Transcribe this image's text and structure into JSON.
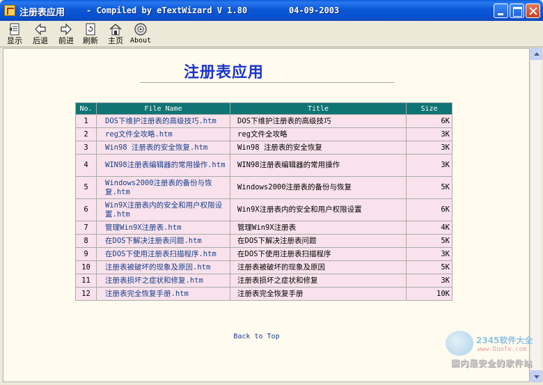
{
  "window": {
    "title": "注册表应用",
    "compiled": "- Compiled by eTextWizard V 1.80",
    "date": "04-09-2003"
  },
  "toolbar": {
    "show_label": "显示",
    "back_label": "后退",
    "forward_label": "前进",
    "refresh_label": "刷新",
    "home_label": "主页",
    "about_label": "About"
  },
  "page": {
    "title": "注册表应用",
    "back_to_top": "Back to Top"
  },
  "table": {
    "headers": [
      "No.",
      "File Name",
      "Title",
      "Size"
    ],
    "rows": [
      {
        "no": "1",
        "file": "DOS下维护注册表的高级技巧.htm",
        "title": "DOS下维护注册表的高级技巧",
        "size": "6K"
      },
      {
        "no": "2",
        "file": "reg文件全攻略.htm",
        "title": "reg文件全攻略",
        "size": "3K"
      },
      {
        "no": "3",
        "file": "Win98 注册表的安全恢复.htm",
        "title": "Win98 注册表的安全恢复",
        "size": "3K"
      },
      {
        "no": "4",
        "file": "WIN98注册表编辑器的常用操作.htm",
        "title": "WIN98注册表编辑器的常用操作",
        "size": "3K"
      },
      {
        "no": "5",
        "file": "Windows2000注册表的备份与恢复.htm",
        "title": "Windows2000注册表的备份与恢复",
        "size": "5K"
      },
      {
        "no": "6",
        "file": "Win9X注册表内的安全和用户权限设置.htm",
        "title": "Win9X注册表内的安全和用户权限设置",
        "size": "6K"
      },
      {
        "no": "7",
        "file": "管理Win9X注册表.htm",
        "title": "管理Win9X注册表",
        "size": "4K"
      },
      {
        "no": "8",
        "file": "在DOS下解决注册表问题.htm",
        "title": "在DOS下解决注册表问题",
        "size": "5K"
      },
      {
        "no": "9",
        "file": "在DOS下使用注册表扫描程序.htm",
        "title": "在DOS下使用注册表扫描程序",
        "size": "3K"
      },
      {
        "no": "10",
        "file": "注册表被破坏的现象及原因.htm",
        "title": "注册表被破坏的现象及原因",
        "size": "5K"
      },
      {
        "no": "11",
        "file": "注册表损坏之症状和修复.htm",
        "title": "注册表损坏之症状和修复",
        "size": "3K"
      },
      {
        "no": "12",
        "file": "注册表完全恢复手册.htm",
        "title": "注册表完全恢复手册",
        "size": "10K"
      }
    ]
  },
  "watermark": {
    "logo": "2345软件大全",
    "domain": "www.DuoTe.com",
    "tagline": "国内最安全的软件站"
  },
  "colors": {
    "title_blue": "#1c35c9",
    "header_teal": "#0f7474",
    "row_pink": "#f9e2ec",
    "page_bg": "#fffbef"
  }
}
